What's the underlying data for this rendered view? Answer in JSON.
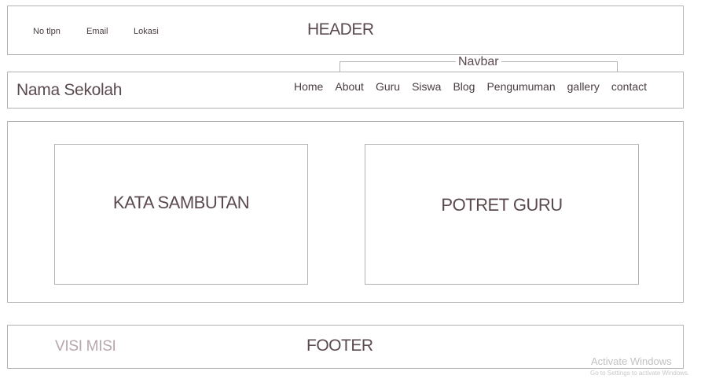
{
  "header": {
    "contacts": [
      "No tlpn",
      "Email",
      "Lokasi"
    ],
    "label": "HEADER"
  },
  "navbar_annotation": "Navbar",
  "nav": {
    "school_name": "Nama Sekolah",
    "items": [
      "Home",
      "About",
      "Guru",
      "Siswa",
      "Blog",
      "Pengumuman",
      "gallery",
      "contact"
    ]
  },
  "main": {
    "welcome_label": "KATA SAMBUTAN",
    "teacher_label": "POTRET GURU"
  },
  "footer": {
    "vision_label": "VISI MISI",
    "label": "FOOTER"
  },
  "watermark": {
    "title": "Activate Windows",
    "subtitle": "Go to Settings to activate Windows."
  }
}
